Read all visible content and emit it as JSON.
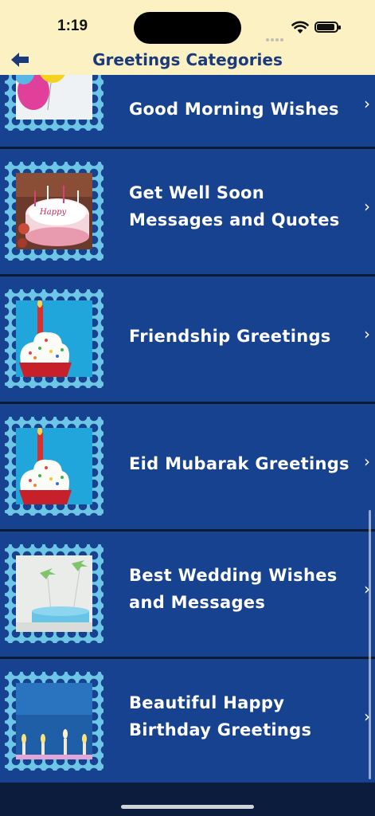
{
  "status": {
    "time": "1:19"
  },
  "nav": {
    "title": "Greetings Categories"
  },
  "categories": [
    {
      "label": "Good Morning Wishes",
      "thumb": "balloons"
    },
    {
      "label": "Get Well Soon Messages and Quotes",
      "thumb": "birthday-cake"
    },
    {
      "label": "Friendship Greetings",
      "thumb": "cupcake-candle"
    },
    {
      "label": "Eid Mubarak Greetings",
      "thumb": "cupcake-candle"
    },
    {
      "label": "Best Wedding Wishes and Messages",
      "thumb": "blue-cake-airplanes"
    },
    {
      "label": "Beautiful Happy Birthday Greetings",
      "thumb": "candles-blue"
    }
  ],
  "colors": {
    "background": "#17428f",
    "header": "#fbf1c2",
    "stamp": "#6dc6e6",
    "divider": "#0d1a33",
    "title": "#1a3a7c"
  }
}
